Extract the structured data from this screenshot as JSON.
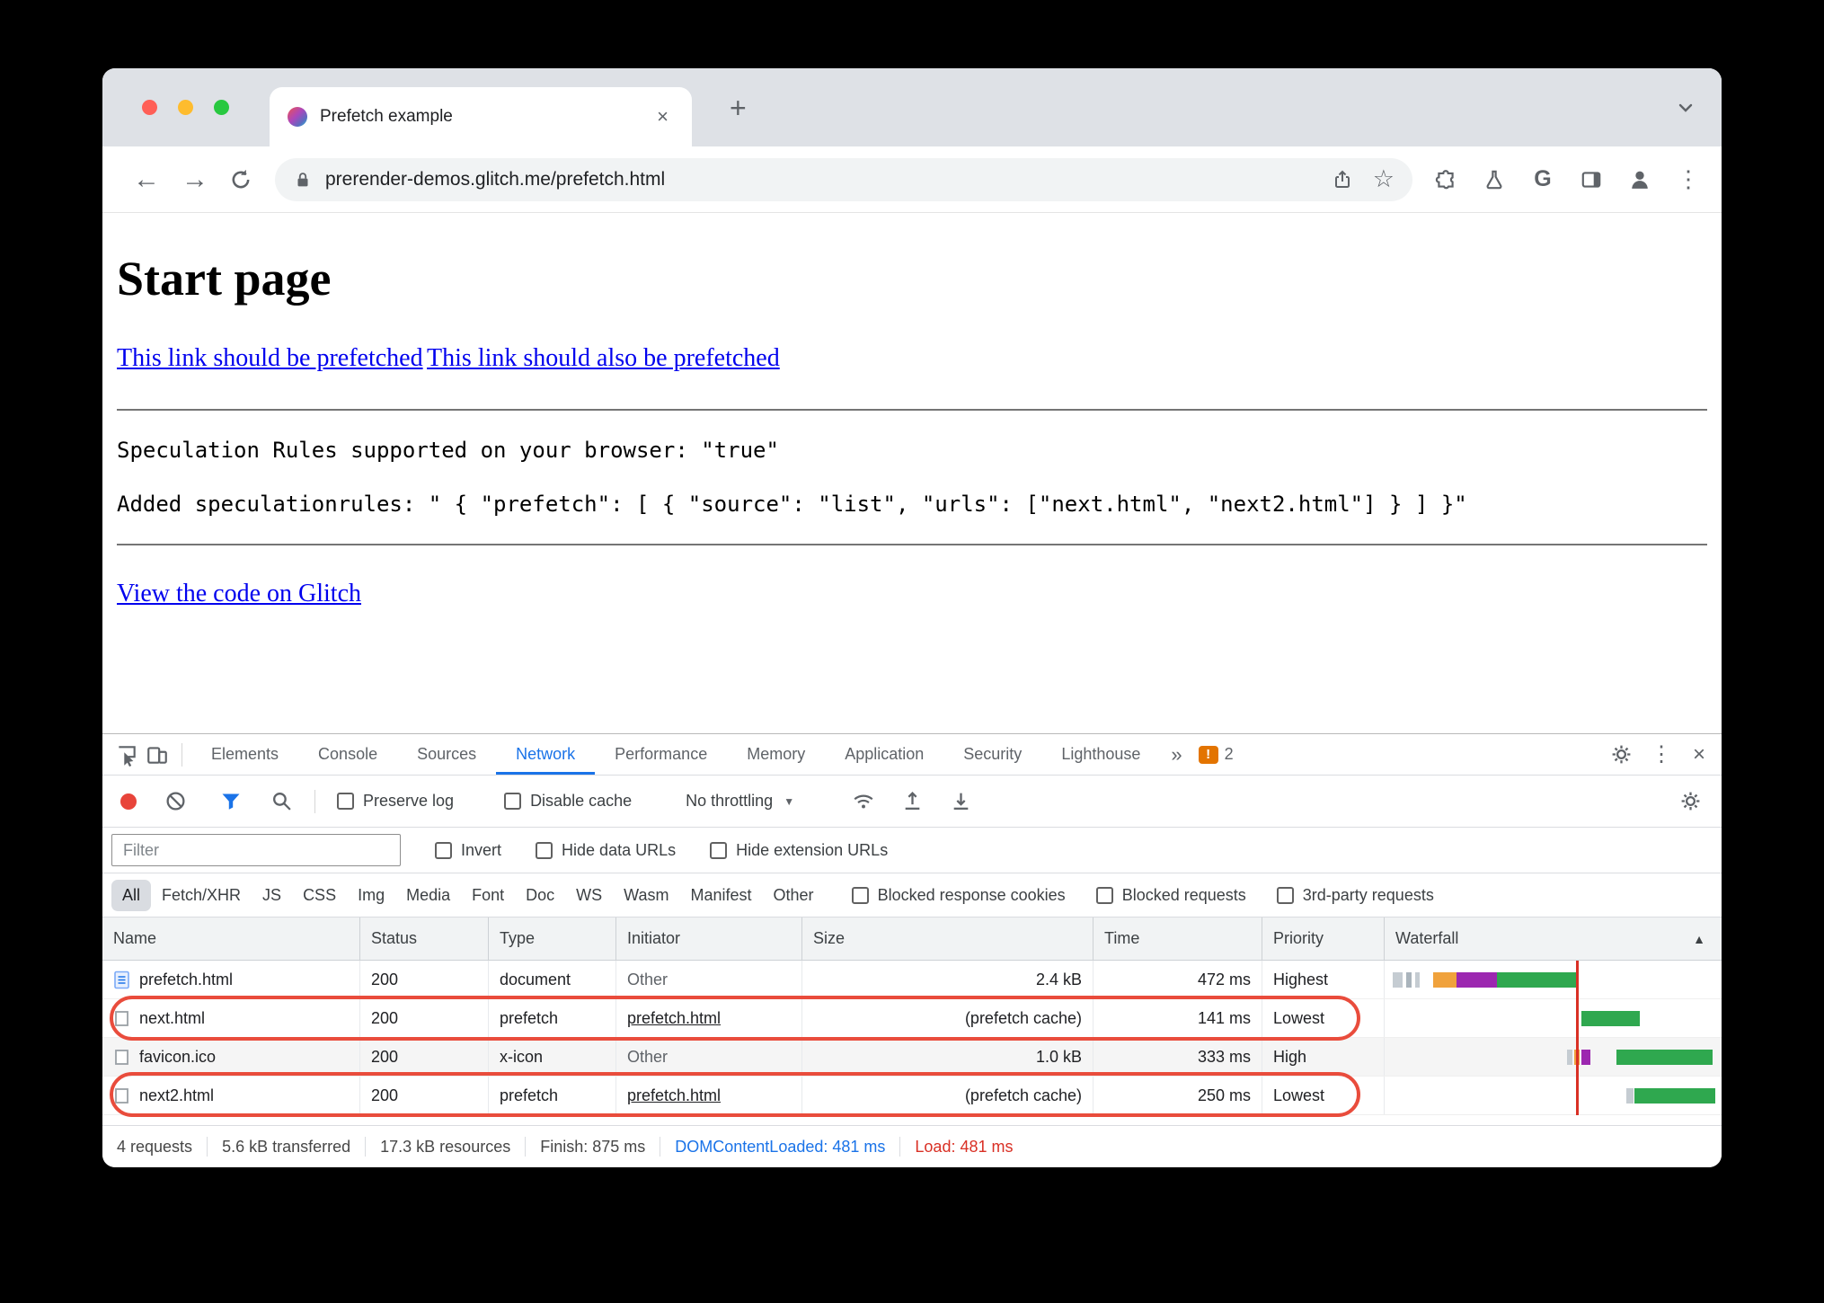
{
  "browser": {
    "tab_title": "Prefetch example",
    "url": "prerender-demos.glitch.me/prefetch.html"
  },
  "page": {
    "title": "Start page",
    "link1": "This link should be prefetched",
    "link2": "This link should also be prefetched",
    "mono_line1": "Speculation Rules supported on your browser: \"true\"",
    "mono_line2": "Added speculationrules: \" { \"prefetch\": [ { \"source\": \"list\", \"urls\": [\"next.html\", \"next2.html\"] } ] }\"",
    "glitch_link": "View the code on Glitch"
  },
  "devtools": {
    "tabs": [
      "Elements",
      "Console",
      "Sources",
      "Network",
      "Performance",
      "Memory",
      "Application",
      "Security",
      "Lighthouse"
    ],
    "active_tab": "Network",
    "warning_count": "2",
    "netbar": {
      "preserve_log": "Preserve log",
      "disable_cache": "Disable cache",
      "throttling": "No throttling"
    },
    "filterbar": {
      "placeholder": "Filter",
      "invert": "Invert",
      "hide_data": "Hide data URLs",
      "hide_ext": "Hide extension URLs"
    },
    "chips": [
      "All",
      "Fetch/XHR",
      "JS",
      "CSS",
      "Img",
      "Media",
      "Font",
      "Doc",
      "WS",
      "Wasm",
      "Manifest",
      "Other"
    ],
    "chip_checks": [
      "Blocked response cookies",
      "Blocked requests",
      "3rd-party requests"
    ],
    "table": {
      "columns": [
        "Name",
        "Status",
        "Type",
        "Initiator",
        "Size",
        "Time",
        "Priority",
        "Waterfall"
      ],
      "rows": [
        {
          "name": "prefetch.html",
          "status": "200",
          "type": "document",
          "initiator": "Other",
          "size": "2.4 kB",
          "time": "472 ms",
          "priority": "Highest"
        },
        {
          "name": "next.html",
          "status": "200",
          "type": "prefetch",
          "initiator": "prefetch.html",
          "size": "(prefetch cache)",
          "time": "141 ms",
          "priority": "Lowest"
        },
        {
          "name": "favicon.ico",
          "status": "200",
          "type": "x-icon",
          "initiator": "Other",
          "size": "1.0 kB",
          "time": "333 ms",
          "priority": "High"
        },
        {
          "name": "next2.html",
          "status": "200",
          "type": "prefetch",
          "initiator": "prefetch.html",
          "size": "(prefetch cache)",
          "time": "250 ms",
          "priority": "Lowest"
        }
      ]
    },
    "status": {
      "requests": "4 requests",
      "transferred": "5.6 kB transferred",
      "resources": "17.3 kB resources",
      "finish": "Finish: 875 ms",
      "dcl": "DOMContentLoaded: 481 ms",
      "load": "Load: 481 ms"
    }
  },
  "icons": {
    "back": "←",
    "forward": "→",
    "star": "☆",
    "google": "G",
    "kebab": "⋮",
    "plus": "+",
    "close": "×",
    "more_tabs": "»",
    "warning": "!",
    "dropdown": "▼",
    "sort_asc": "▲"
  },
  "colors": {
    "accent_blue": "#1a73e8",
    "annotation_red": "#e94c3c",
    "load_line_red": "#d93025",
    "dcl_blue": "#1a73e8",
    "waterfall_green": "#2fa84f",
    "waterfall_orange": "#f0a23c",
    "waterfall_purple": "#9c27b0",
    "link_blue": "#0000ee",
    "tabstrip_bg": "#dee1e6",
    "traffic_red": "#ff5f57",
    "traffic_yellow": "#febc2e",
    "traffic_green": "#28c840"
  }
}
